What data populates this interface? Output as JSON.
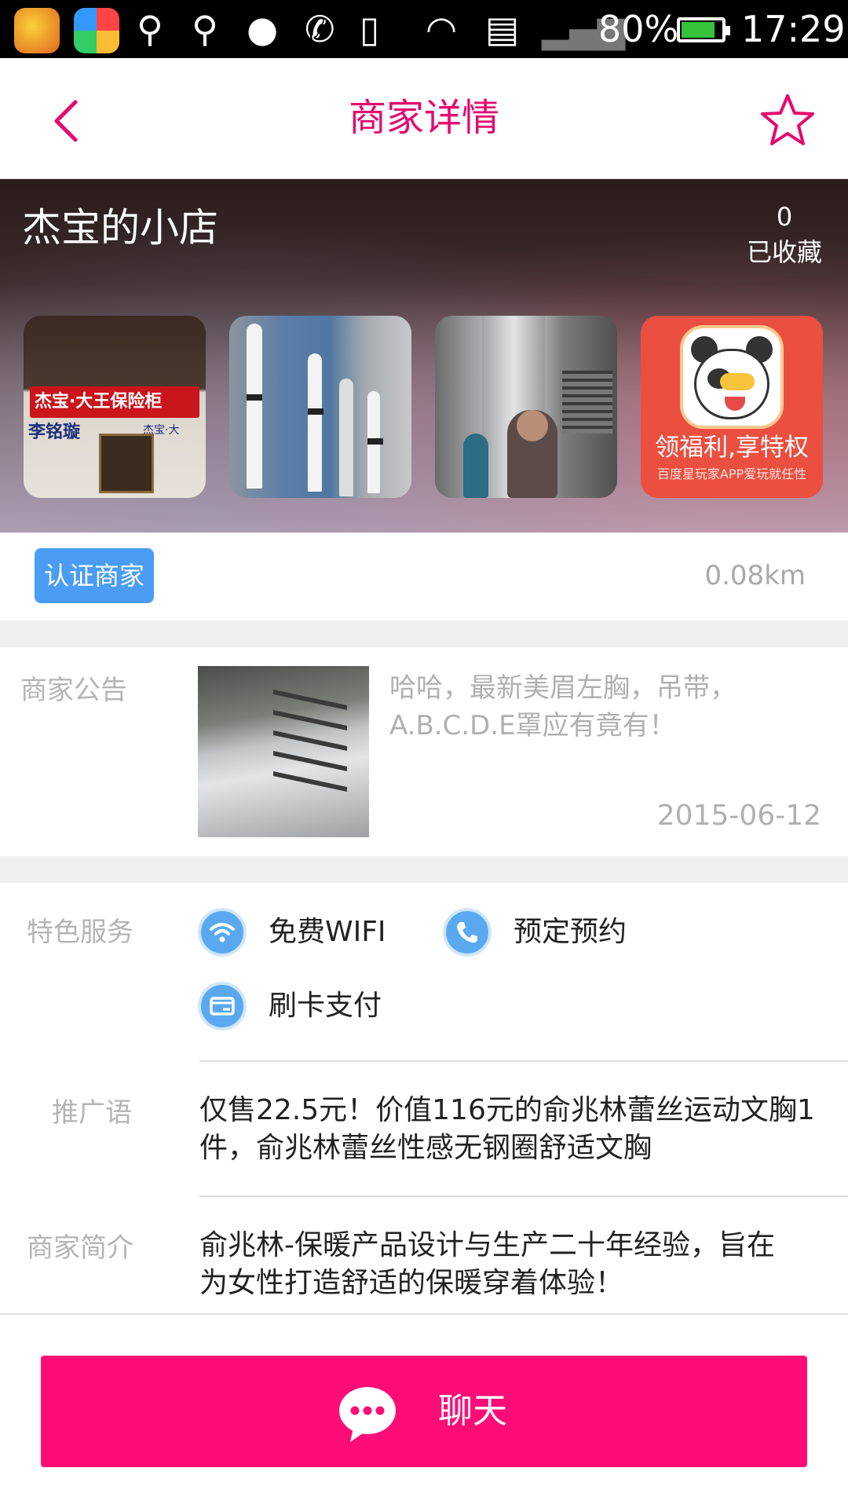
{
  "status_bar": {
    "battery_percent": "80%",
    "time": "17:29",
    "battery_fill": 0.8
  },
  "header": {
    "title": "商家详情",
    "back_icon": "chevron-left-icon",
    "favorite_icon": "star-outline-icon",
    "accent_color": "#e5096f"
  },
  "shop": {
    "name": "杰宝的小店",
    "favorites_count": "0",
    "favorites_label": "已收藏",
    "gallery": [
      {
        "sign": "杰宝·大王保险柜",
        "text": "李铭璇",
        "brand": "杰宝·大"
      },
      {},
      {},
      {
        "title": "领福利,享特权",
        "subtitle": "百度星玩家APP爱玩就任性"
      }
    ]
  },
  "cert": {
    "badge": "认证商家",
    "badge_color": "#4a9cf4",
    "distance": "0.08km"
  },
  "announcement": {
    "label": "商家公告",
    "text": "哈哈，最新美眉左胸，吊带，A.B.C.D.E罩应有竟有！",
    "date": "2015-06-12"
  },
  "services": {
    "label": "特色服务",
    "items": [
      {
        "icon": "wifi-icon",
        "label": "免费WIFI"
      },
      {
        "icon": "phone-icon",
        "label": "预定预约"
      },
      {
        "icon": "card-icon",
        "label": "刷卡支付"
      }
    ]
  },
  "promo": {
    "label": "推广语",
    "text": "仅售22.5元！价值116元的俞兆林蕾丝运动文胸1件，俞兆林蕾丝性感无钢圈舒适文胸"
  },
  "intro": {
    "label": "商家简介",
    "text": "俞兆林-保暖产品设计与生产二十年经验，旨在为女性打造舒适的保暖穿着体验！"
  },
  "chat": {
    "label": "聊天",
    "icon": "chat-bubble-icon",
    "color": "#fe0d76"
  }
}
